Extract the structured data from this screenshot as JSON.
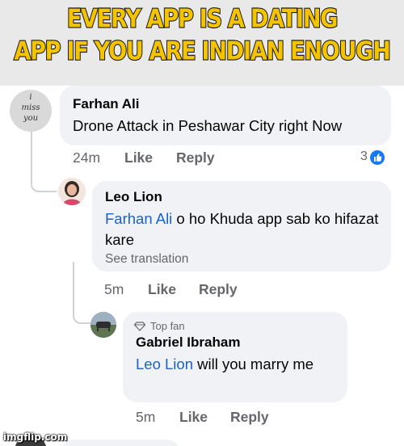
{
  "caption": {
    "line1": "EVERY APP IS A DATING",
    "line2": "APP IF YOU ARE INDIAN ENOUGH"
  },
  "comments": [
    {
      "author": "Farhan Ali",
      "avatar_text": [
        "i",
        "miss",
        "you"
      ],
      "text": "Drone Attack in Peshawar City right Now",
      "time": "24m",
      "like_label": "Like",
      "reply_label": "Reply",
      "reaction_count": "3",
      "reaction_icon": "thumbs-up-icon"
    },
    {
      "author": "Leo Lion",
      "mention": "Farhan Ali",
      "text": " o ho Khuda app sab ko hifazat kare",
      "see_translation": "See translation",
      "time": "5m",
      "like_label": "Like",
      "reply_label": "Reply"
    },
    {
      "badge": "Top fan",
      "author": "Gabriel Ibraham",
      "mention": "Leo Lion",
      "text": " will you marry me",
      "time": "5m",
      "like_label": "Like",
      "reply_label": "Reply"
    }
  ],
  "watermark": "imgflip.com",
  "colors": {
    "caption_fill": "#f5c400",
    "mention_blue": "#1b61c9",
    "bubble_gray": "#f0f2f5",
    "meta_gray": "#65676b",
    "like_blue": "#1877f2"
  }
}
